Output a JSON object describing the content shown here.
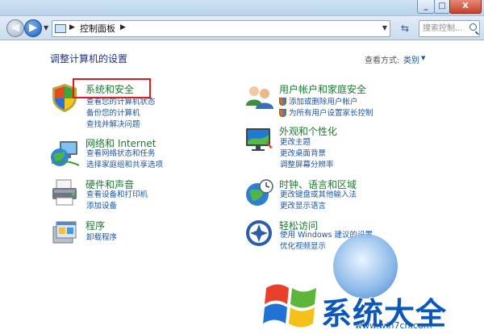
{
  "window": {
    "minimize": "_",
    "maximize": "□",
    "close": "X"
  },
  "nav": {
    "breadcrumb_root_icon": "control-panel-icon",
    "breadcrumb": "控制面板",
    "search_placeholder": "搜索控制...",
    "refresh_icon": "refresh-icon"
  },
  "header": {
    "title": "调整计算机的设置",
    "view_by_label": "查看方式:",
    "view_by_value": "类别"
  },
  "categories": [
    {
      "title": "系统和安全",
      "icon": "shield-icon",
      "links": [
        "查看您的计算机状态",
        "备份您的计算机",
        "查找并解决问题"
      ]
    },
    {
      "title": "网络和 Internet",
      "icon": "network-globe-icon",
      "links": [
        "查看网络状态和任务",
        "选择家庭组和共享选项"
      ]
    },
    {
      "title": "硬件和声音",
      "icon": "printer-icon",
      "links": [
        "查看设备和打印机",
        "添加设备"
      ]
    },
    {
      "title": "程序",
      "icon": "programs-icon",
      "links": [
        "卸载程序"
      ]
    },
    {
      "title": "用户帐户和家庭安全",
      "icon": "users-icon",
      "links": [
        "添加或删除用户帐户",
        "为所有用户设置家长控制"
      ]
    },
    {
      "title": "外观和个性化",
      "icon": "display-icon",
      "links": [
        "更改主题",
        "更改桌面背景",
        "调整屏幕分辨率"
      ]
    },
    {
      "title": "时钟、语言和区域",
      "icon": "clock-globe-icon",
      "links": [
        "更改键盘或其他输入法",
        "更改显示语言"
      ]
    },
    {
      "title": "轻松访问",
      "icon": "ease-of-access-icon",
      "links": [
        "使用 Windows 建议的设置",
        "优化视频显示"
      ]
    }
  ],
  "watermark": {
    "text": "系统大全",
    "url": "www.win7cn.com"
  },
  "colors": {
    "category_title": "#1a7a30",
    "link": "#1b55a6",
    "highlight": "#e21a1a"
  }
}
